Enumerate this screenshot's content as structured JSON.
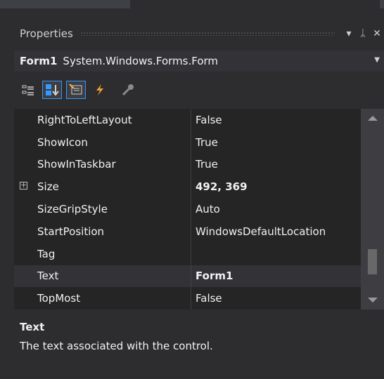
{
  "panel": {
    "title": "Properties",
    "dropdown_glyph": "▾",
    "pin_glyph": "ᛦ",
    "close_glyph": "✕"
  },
  "object": {
    "name": "Form1",
    "type": "System.Windows.Forms.Form"
  },
  "toolbar": {
    "icons": [
      "categorized-icon",
      "alphabetical-icon",
      "properties-icon",
      "events-icon",
      "property-pages-icon"
    ]
  },
  "properties": [
    {
      "name": "RightToLeftLayout",
      "value": "False",
      "bold": false
    },
    {
      "name": "ShowIcon",
      "value": "True",
      "bold": false
    },
    {
      "name": "ShowInTaskbar",
      "value": "True",
      "bold": false
    },
    {
      "name": "Size",
      "value": "492, 369",
      "bold": true,
      "expandable": true,
      "expander": "+"
    },
    {
      "name": "SizeGripStyle",
      "value": "Auto",
      "bold": false
    },
    {
      "name": "StartPosition",
      "value": "WindowsDefaultLocation",
      "bold": false
    },
    {
      "name": "Tag",
      "value": "",
      "bold": false
    },
    {
      "name": "Text",
      "value": "Form1",
      "bold": true,
      "selected": true
    },
    {
      "name": "TopMost",
      "value": "False",
      "bold": false
    }
  ],
  "description": {
    "title": "Text",
    "text": "The text associated with the control."
  },
  "colors": {
    "background": "#2d2d30",
    "grid": "#252526",
    "accent": "#3399ff"
  }
}
